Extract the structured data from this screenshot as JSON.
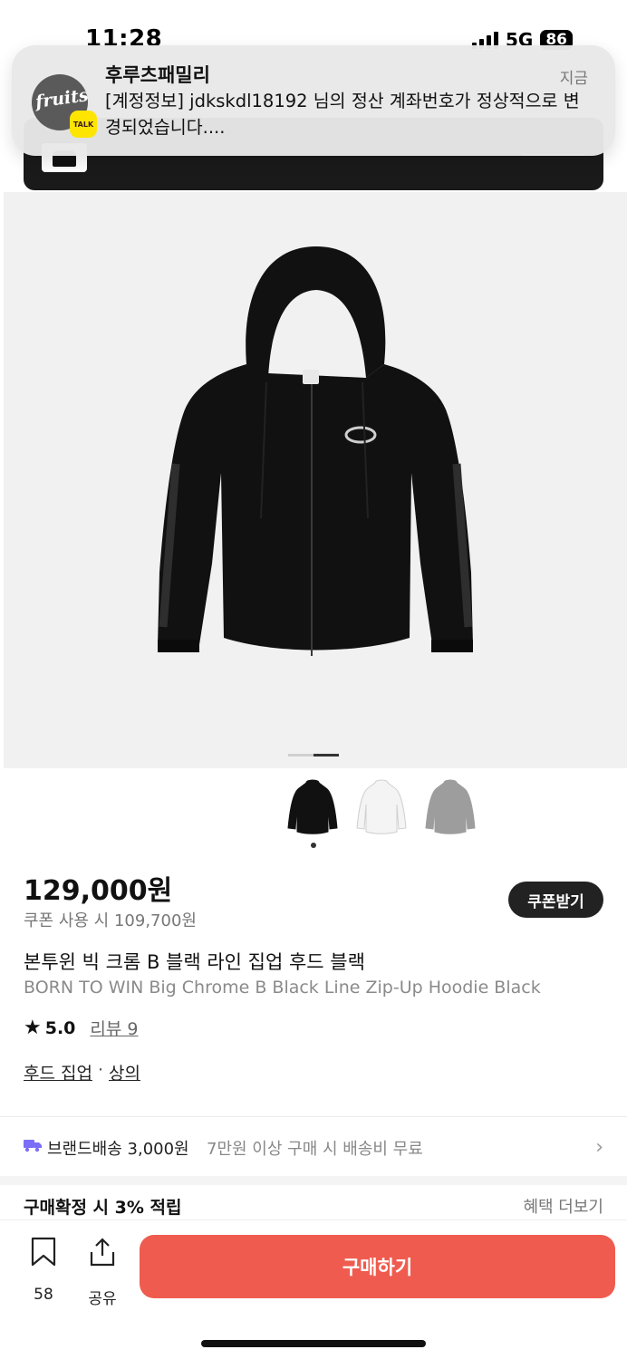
{
  "status_bar": {
    "time": "11:28",
    "network": "5G",
    "battery": "86"
  },
  "notification": {
    "app_name": "후루츠패밀리",
    "time": "지금",
    "message": "[계정정보] jdkskdl18192 님의 정산 계좌번호가 정상적으로 변경되었습니다....",
    "badge": "TALK",
    "avatar_text": "fruits"
  },
  "product": {
    "price": "129,000원",
    "coupon_price": "쿠폰 사용 시 109,700원",
    "coupon_button": "쿠폰받기",
    "name_ko": "본투윈 빅 크롬 B 블랙 라인 집업 후드 블랙",
    "name_en": "BORN TO WIN Big Chrome B Black Line Zip-Up Hoodie Black",
    "rating": "5.0",
    "review_label": "리뷰 9",
    "categories": [
      "후드 집업",
      "상의"
    ],
    "category_separator": "·",
    "image_count": 2,
    "active_image": 2,
    "color_options": [
      {
        "name": "black-hoodie",
        "color": "#111111"
      },
      {
        "name": "white-hoodie",
        "color": "#f4f4f4"
      },
      {
        "name": "gray-hoodie",
        "color": "#9d9d9d"
      }
    ]
  },
  "shipping": {
    "label": "브랜드배송 3,000원",
    "note": "7만원 이상 구매 시 배송비 무료",
    "icon": "truck-icon",
    "icon_color": "#7b6ef6"
  },
  "benefits": {
    "points": "구매확정 시 3% 적립",
    "more": "혜택 더보기"
  },
  "bottom_bar": {
    "bookmark_count": "58",
    "share_label": "공유",
    "buy_label": "구매하기",
    "buy_color": "#ef5c4f"
  }
}
